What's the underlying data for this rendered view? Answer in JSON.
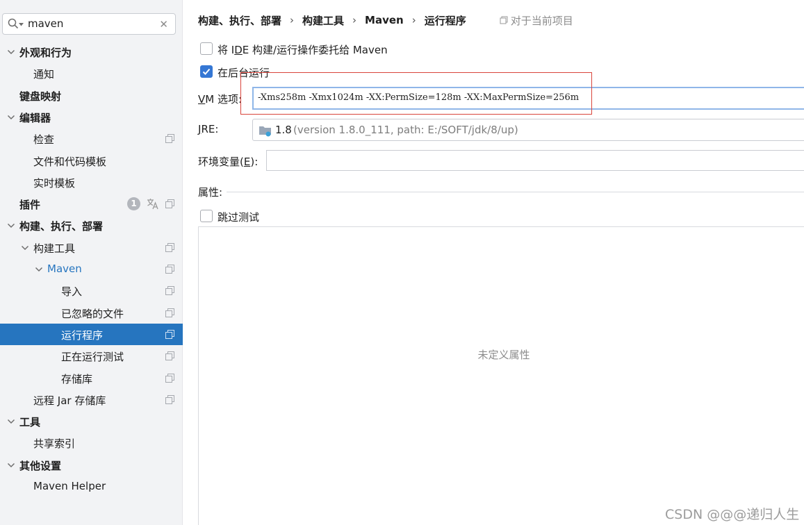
{
  "search": {
    "value": "maven"
  },
  "tree": {
    "items": [
      {
        "label": "外观和行为",
        "bold": true,
        "level": 0,
        "expanded": true
      },
      {
        "label": "通知",
        "level": 1
      },
      {
        "label": "键盘映射",
        "bold": true,
        "level": 0
      },
      {
        "label": "编辑器",
        "bold": true,
        "level": 0,
        "expanded": true
      },
      {
        "label": "检查",
        "level": 1,
        "copy": true
      },
      {
        "label": "文件和代码模板",
        "level": 1
      },
      {
        "label": "实时模板",
        "level": 1
      },
      {
        "label": "插件",
        "bold": true,
        "level": 0,
        "badge": "1",
        "copy": true
      },
      {
        "label": "构建、执行、部署",
        "bold": true,
        "level": 0,
        "expanded": true
      },
      {
        "label": "构建工具",
        "level": 1,
        "expanded": true,
        "copy": true
      },
      {
        "label": "Maven",
        "level": 2,
        "expanded": true,
        "link": true,
        "copy": true
      },
      {
        "label": "导入",
        "level": 3,
        "copy": true
      },
      {
        "label": "已忽略的文件",
        "level": 3,
        "copy": true
      },
      {
        "label": "运行程序",
        "level": 3,
        "copy": true,
        "selected": true
      },
      {
        "label": "正在运行测试",
        "level": 3,
        "copy": true
      },
      {
        "label": "存储库",
        "level": 3,
        "copy": true
      },
      {
        "label": "远程 Jar 存储库",
        "level": 1,
        "copy": true
      },
      {
        "label": "工具",
        "bold": true,
        "level": 0,
        "expanded": true
      },
      {
        "label": "共享索引",
        "level": 1
      },
      {
        "label": "其他设置",
        "bold": true,
        "level": 0,
        "expanded": true
      },
      {
        "label": "Maven Helper",
        "level": 1
      }
    ]
  },
  "breadcrumb": {
    "items": [
      "构建、执行、部署",
      "构建工具",
      "Maven",
      "运行程序"
    ],
    "separator": "›",
    "scope_hint": "对于当前项目"
  },
  "delegate": {
    "label_pre": "将 I",
    "label_mnemonic": "D",
    "label_post": "E 构建/运行操作委托给 Maven",
    "checked": false
  },
  "background": {
    "label": "在后台运行",
    "checked": true
  },
  "vm_options": {
    "label_mnemonic": "V",
    "label_rest": "M 选项:",
    "value": "-Xms258m -Xmx1024m -XX:PermSize=128m -XX:MaxPermSize=256m"
  },
  "jre": {
    "label_mnemonic": "J",
    "label_rest": "RE:",
    "version": "1.8",
    "detail": "(version 1.8.0_111, path: E:/SOFT/jdk/8/up)"
  },
  "env": {
    "label_pre": "环境变量(",
    "label_mnemonic": "E",
    "label_post": "):"
  },
  "properties": {
    "title": "属性:",
    "skip_tests_label": "跳过测试",
    "skip_tests_checked": false,
    "empty_text": "未定义属性"
  },
  "watermark": "CSDN @@@递归人生",
  "colors": {
    "accent": "#2675bf",
    "checkbox": "#3577d4",
    "highlight": "#d9443b"
  }
}
